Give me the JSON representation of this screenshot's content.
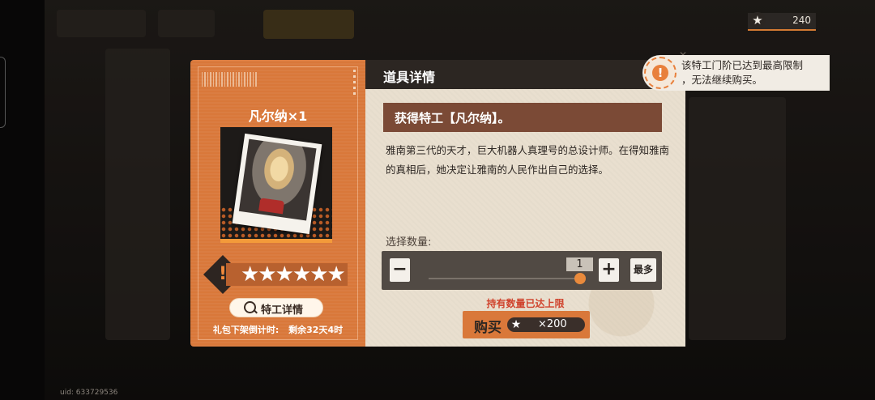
{
  "currency": {
    "icon": "star-coin-icon",
    "amount": "240"
  },
  "card": {
    "item_name": "凡尔纳×1",
    "rank_icon": "!",
    "stars": "★★★★★★",
    "detail_button": "特工详情",
    "countdown_label": "礼包下架倒计时:",
    "countdown_value": "剩余32天4时"
  },
  "panel": {
    "title": "道具详情",
    "obtain_text": "获得特工【凡尔纳】。",
    "description": "雅南第三代的天才，巨大机器人真理号的总设计师。在得知雅南的真相后，她决定让雅南的人民作出自己的选择。",
    "quantity_label": "选择数量:",
    "minus_label": "−",
    "plus_label": "+",
    "max_label": "最多",
    "quantity_value": "1",
    "limit_warning": "持有数量已达上限",
    "buy_label": "购买",
    "price": "×200"
  },
  "toast": {
    "icon": "!",
    "message_line1": "该特工门阶已达到最高限制",
    "message_line2": "，无法继续购买。"
  },
  "uid": "uid: 633729536",
  "colors": {
    "accent": "#d9783a",
    "dark": "#2c2622",
    "warning": "#d0432d"
  }
}
